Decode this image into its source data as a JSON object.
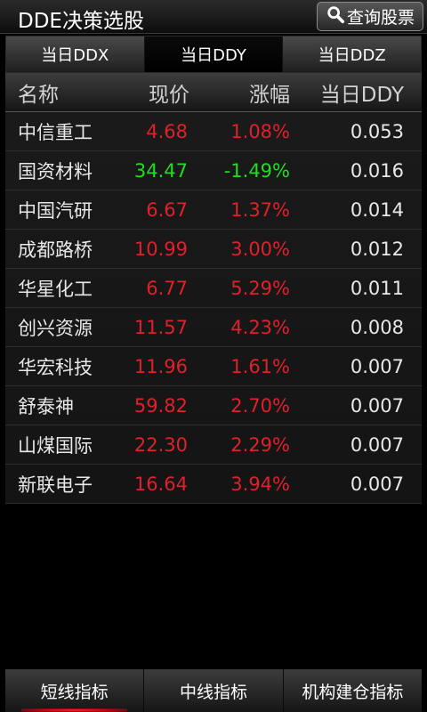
{
  "header": {
    "title": "DDE决策选股",
    "query_label": "查询股票"
  },
  "tabs": [
    {
      "label": "当日DDX"
    },
    {
      "label": "当日DDY"
    },
    {
      "label": "当日DDZ"
    }
  ],
  "columns": {
    "name": "名称",
    "price": "现价",
    "change": "涨幅",
    "ddy": "当日DDY"
  },
  "rows": [
    {
      "name": "中信重工",
      "price": "4.68",
      "change": "1.08%",
      "ddy": "0.053"
    },
    {
      "name": "国资材料",
      "price": "34.47",
      "change": "-1.49%",
      "ddy": "0.016"
    },
    {
      "name": "中国汽研",
      "price": "6.67",
      "change": "1.37%",
      "ddy": "0.014"
    },
    {
      "name": "成都路桥",
      "price": "10.99",
      "change": "3.00%",
      "ddy": "0.012"
    },
    {
      "name": "华星化工",
      "price": "6.77",
      "change": "5.29%",
      "ddy": "0.011"
    },
    {
      "name": "创兴资源",
      "price": "11.57",
      "change": "4.23%",
      "ddy": "0.008"
    },
    {
      "name": "华宏科技",
      "price": "11.96",
      "change": "1.61%",
      "ddy": "0.007"
    },
    {
      "name": "舒泰神",
      "price": "59.82",
      "change": "2.70%",
      "ddy": "0.007"
    },
    {
      "name": "山煤国际",
      "price": "22.30",
      "change": "2.29%",
      "ddy": "0.007"
    },
    {
      "name": "新联电子",
      "price": "16.64",
      "change": "3.94%",
      "ddy": "0.007"
    }
  ],
  "bottom_tabs": [
    {
      "label": "短线指标"
    },
    {
      "label": "中线指标"
    },
    {
      "label": "机构建仓指标"
    }
  ],
  "colors": {
    "up": "#e0202a",
    "down": "#22dd22"
  },
  "icons": {
    "query": "search-icon"
  }
}
